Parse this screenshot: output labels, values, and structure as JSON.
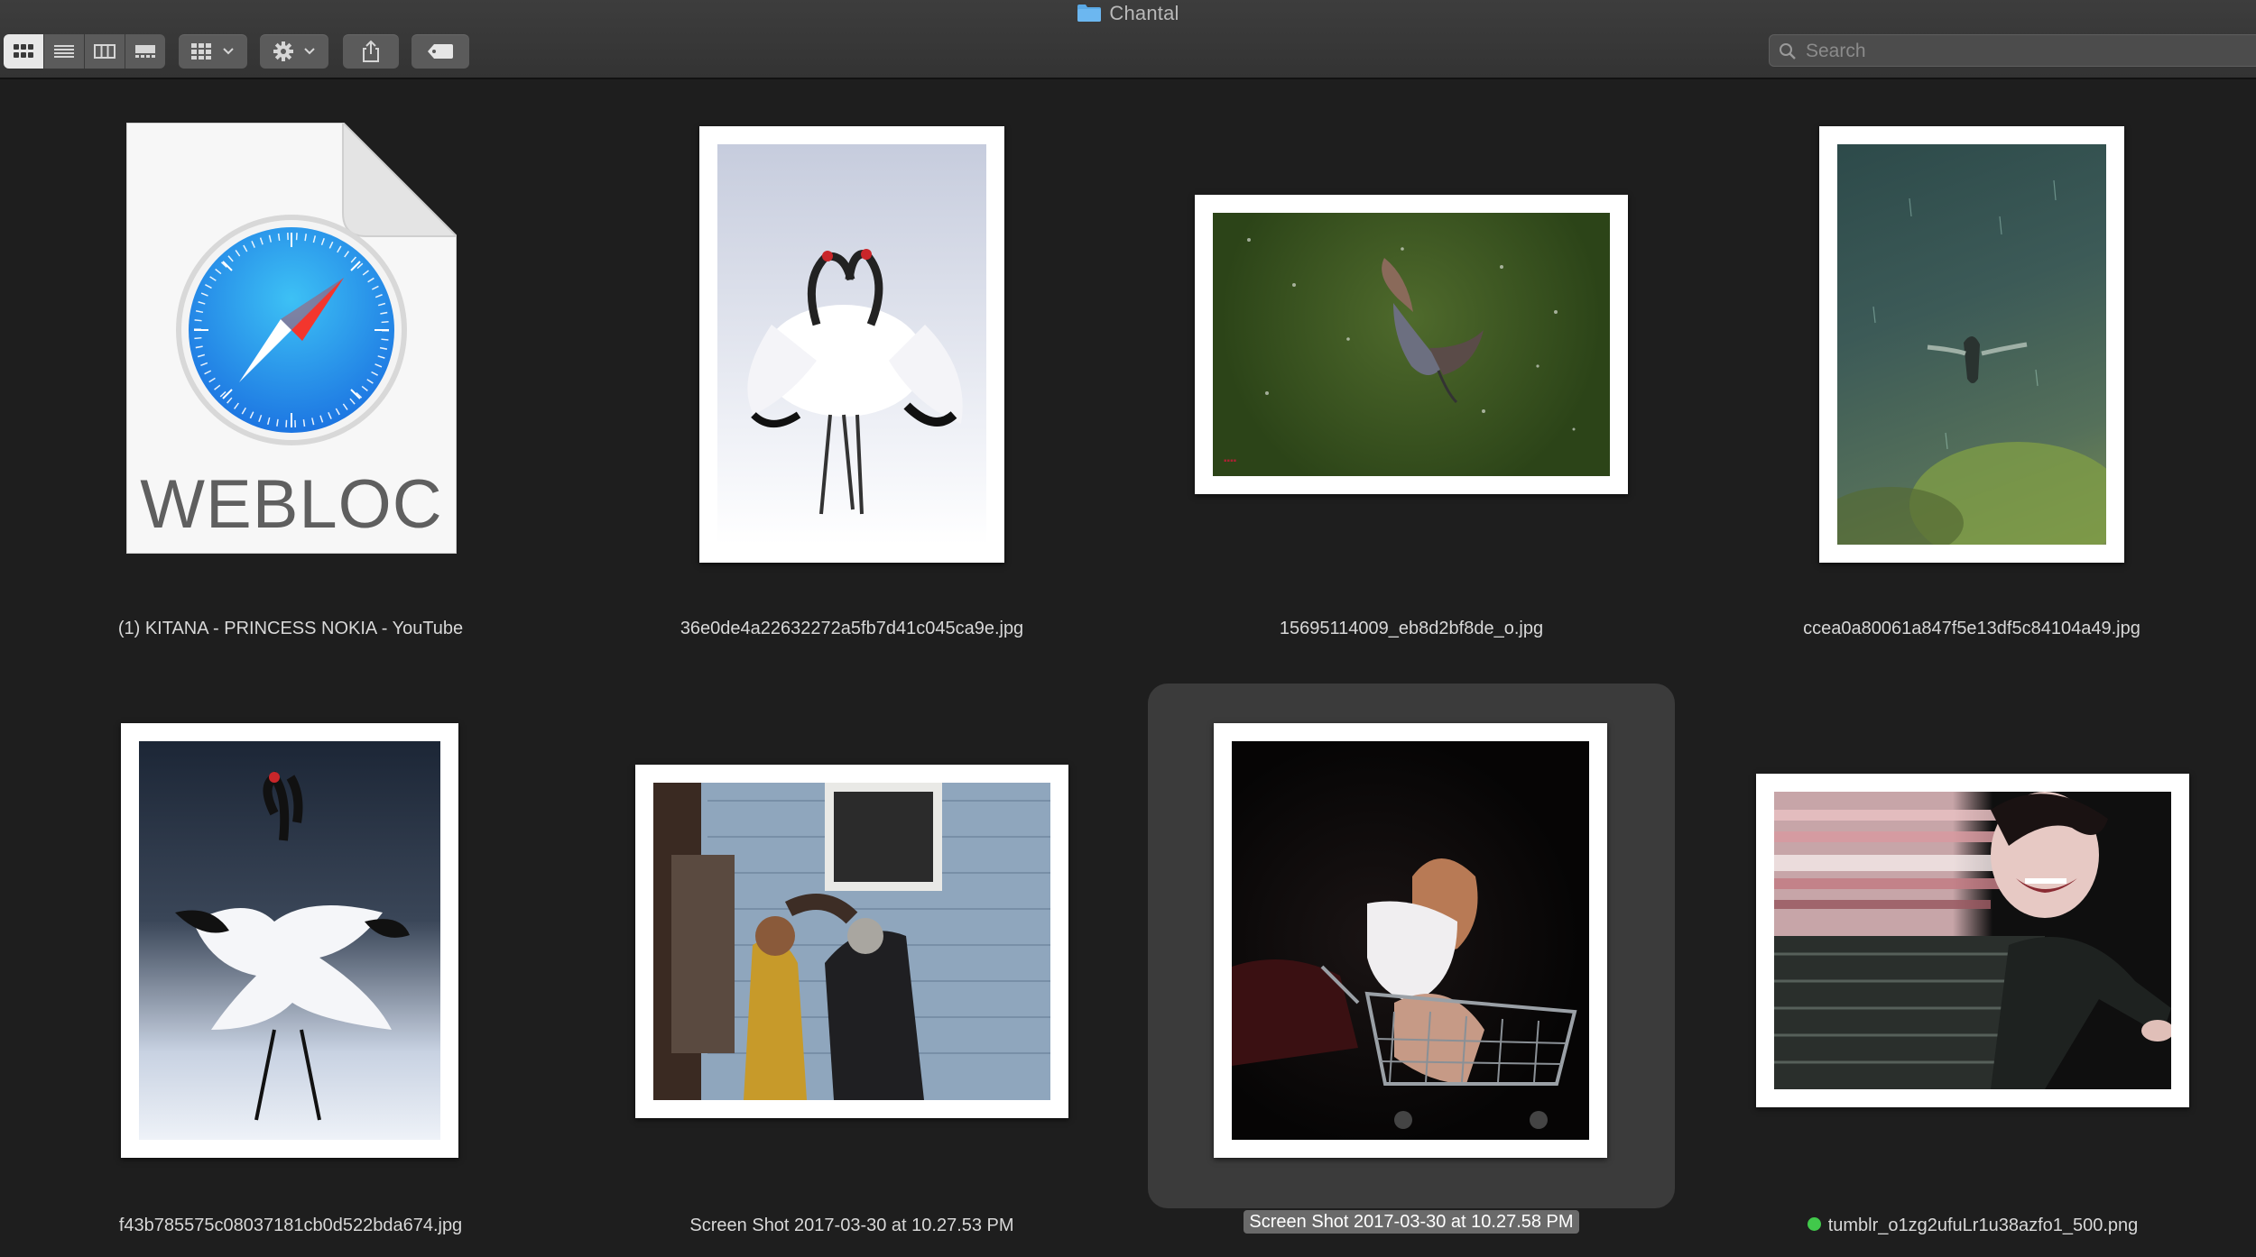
{
  "window": {
    "title": "Chantal"
  },
  "toolbar": {
    "view_modes": [
      {
        "icon": "icon-view-icon",
        "active": true
      },
      {
        "icon": "list-view-icon",
        "active": false
      },
      {
        "icon": "column-view-icon",
        "active": false
      },
      {
        "icon": "gallery-view-icon",
        "active": false
      }
    ],
    "group_icon": "grid-group-icon",
    "action_icon": "gear-icon",
    "share_icon": "share-icon",
    "tag_icon": "tag-icon",
    "search": {
      "placeholder": "Search",
      "value": ""
    }
  },
  "files": [
    {
      "name": "(1) KITANA - PRINCESS NOKIA - YouTube",
      "kind": "webloc",
      "badge": "WEBLOC"
    },
    {
      "name": "36e0de4a22632272a5fb7d41c045ca9e.jpg",
      "kind": "image"
    },
    {
      "name": "15695114009_eb8d2bf8de_o.jpg",
      "kind": "image"
    },
    {
      "name": "ccea0a80061a847f5e13df5c84104a49.jpg",
      "kind": "image"
    },
    {
      "name": "f43b785575c08037181cb0d522bda674.jpg",
      "kind": "image"
    },
    {
      "name": "Screen Shot 2017-03-30 at 10.27.53 PM",
      "kind": "image"
    },
    {
      "name": "Screen Shot 2017-03-30 at 10.27.58 PM",
      "kind": "image",
      "selected": true
    },
    {
      "name": "tumblr_o1zg2ufuLr1u38azfo1_500.png",
      "kind": "image",
      "tag_color": "#41c94b"
    }
  ],
  "colors": {
    "background": "#1e1e1e",
    "toolbar": "#3a3a3a",
    "selection": "#3b3b3b",
    "tag_green": "#41c94b"
  }
}
